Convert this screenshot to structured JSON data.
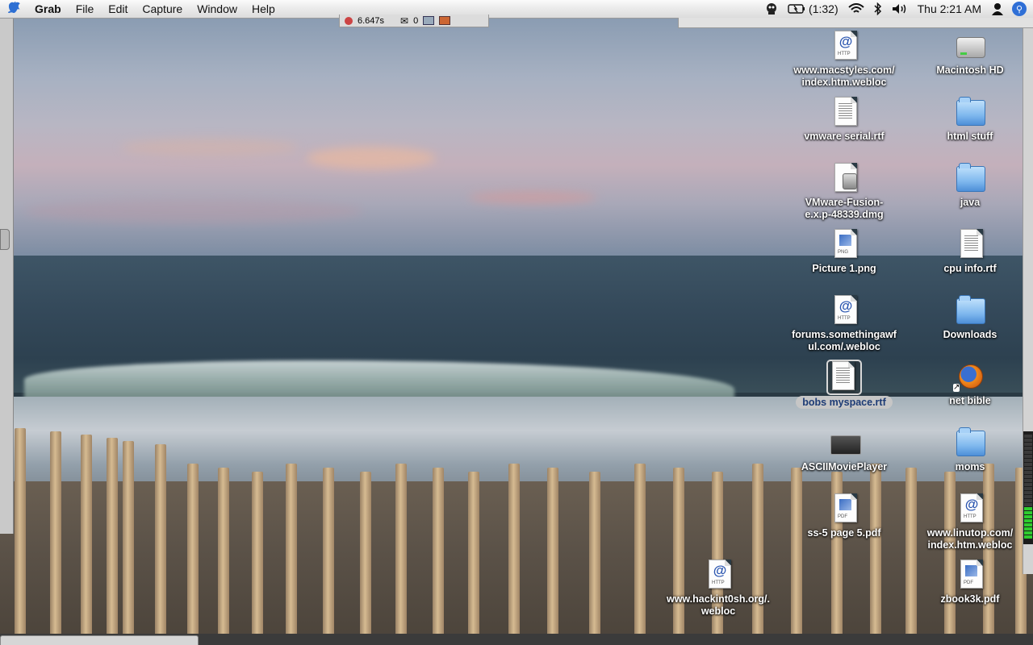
{
  "menubar": {
    "apple_icon": "apple-logo",
    "items": [
      "Grab",
      "File",
      "Edit",
      "Capture",
      "Window",
      "Help"
    ],
    "battery_text": "(1:32)",
    "clock": "Thu 2:21 AM"
  },
  "topstrip": {
    "timer": "6.647s",
    "mail_count": "0"
  },
  "desktop_icons": [
    {
      "label": "www.macstyles.com/\nindex.htm.webloc",
      "kind": "webloc"
    },
    {
      "label": "Macintosh HD",
      "kind": "harddisk"
    },
    {
      "label": "vmware serial.rtf",
      "kind": "rtf"
    },
    {
      "label": "html stuff",
      "kind": "folder"
    },
    {
      "label": "VMware-Fusion-\ne.x.p-48339.dmg",
      "kind": "dmg"
    },
    {
      "label": "java",
      "kind": "folder"
    },
    {
      "label": "Picture 1.png",
      "kind": "png"
    },
    {
      "label": "cpu info.rtf",
      "kind": "rtf"
    },
    {
      "label": "forums.somethingawf\nul.com/.webloc",
      "kind": "webloc"
    },
    {
      "label": "Downloads",
      "kind": "folder"
    },
    {
      "label": "bobs myspace.rtf",
      "kind": "rtf",
      "selected": true
    },
    {
      "label": "net bible",
      "kind": "firefox-alias"
    },
    {
      "label": "ASCIIMoviePlayer",
      "kind": "app"
    },
    {
      "label": "moms",
      "kind": "folder"
    },
    {
      "label": "ss-5 page 5.pdf",
      "kind": "pdf"
    },
    {
      "label": "www.linutop.com/\nindex.htm.webloc",
      "kind": "webloc"
    },
    {
      "label": "www.hackint0sh.org/.\nwebloc",
      "kind": "webloc"
    },
    {
      "label": "zbook3k.pdf",
      "kind": "pdf"
    }
  ],
  "colors": {
    "menubar_top": "#fbfbfb",
    "spotlight": "#2f6fd6",
    "selection_label": "#c6c6c6"
  }
}
